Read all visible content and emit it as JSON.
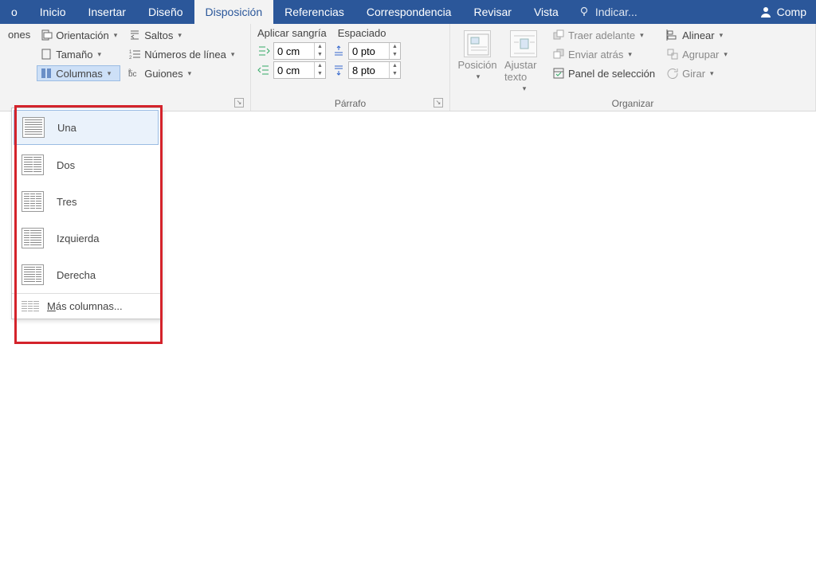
{
  "tabs": {
    "t0": "o",
    "inicio": "Inicio",
    "insertar": "Insertar",
    "diseno": "Diseño",
    "disposicion": "Disposición",
    "referencias": "Referencias",
    "correspondencia": "Correspondencia",
    "revisar": "Revisar",
    "vista": "Vista",
    "tellme": "Indicar...",
    "share": "Comp"
  },
  "pagesetup": {
    "ones_fragment": "ones",
    "orientacion": "Orientación",
    "tamano": "Tamaño",
    "columnas": "Columnas",
    "saltos": "Saltos",
    "numeros": "Números de línea",
    "guiones": "Guiones"
  },
  "paragraph": {
    "sangria_hdr": "Aplicar sangría",
    "espaciado_hdr": "Espaciado",
    "left": "0 cm",
    "right": "0 cm",
    "before": "0 pto",
    "after": "8 pto",
    "label": "Párrafo"
  },
  "arrange": {
    "posicion": "Posición",
    "ajustar": "Ajustar texto",
    "traer": "Traer adelante",
    "enviar": "Enviar atrás",
    "panel": "Panel de selección",
    "alinear": "Alinear",
    "agrupar": "Agrupar",
    "girar": "Girar",
    "label": "Organizar"
  },
  "columns_menu": {
    "una": "Una",
    "dos": "Dos",
    "tres": "Tres",
    "izquierda": "Izquierda",
    "derecha": "Derecha",
    "mas_pre": "M",
    "mas_rest": "ás columnas..."
  }
}
